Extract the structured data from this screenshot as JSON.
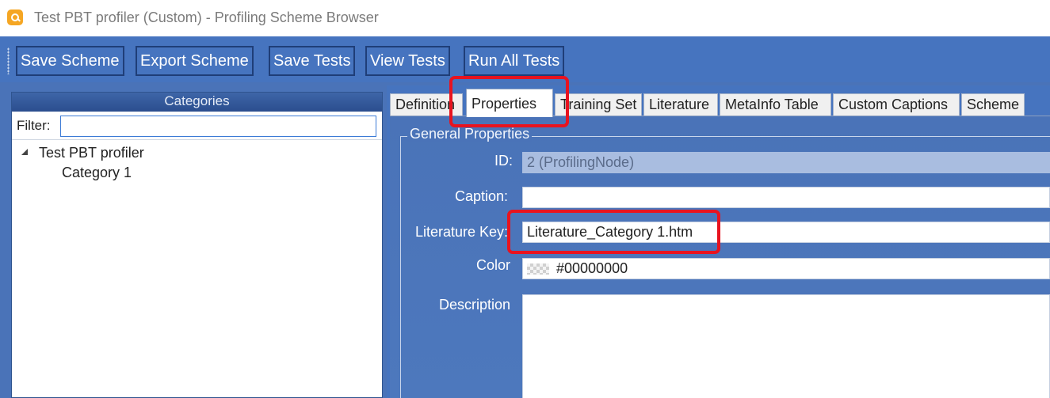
{
  "window": {
    "title": "Test PBT profiler (Custom) - Profiling Scheme Browser"
  },
  "toolbar": {
    "buttons": [
      "Save Scheme",
      "Export Scheme",
      "Save Tests",
      "View Tests",
      "Run All Tests"
    ]
  },
  "categories_panel": {
    "header": "Categories",
    "filter_label": "Filter:",
    "filter_value": "",
    "tree": {
      "root": "Test PBT profiler",
      "children": [
        "Category 1"
      ]
    }
  },
  "tabs": {
    "items": [
      "Definition",
      "Properties",
      "Training Set",
      "Literature",
      "MetaInfo Table",
      "Custom Captions",
      "Scheme"
    ],
    "active": "Properties"
  },
  "general_properties": {
    "title": "General Properties",
    "id_label": "ID:",
    "id_value": "2 (ProfilingNode)",
    "caption_label": "Caption:",
    "caption_value": "",
    "literature_key_label": "Literature Key:",
    "literature_key_value": "Literature_Category 1.htm",
    "color_label": "Color",
    "color_value": "#00000000",
    "description_label": "Description",
    "description_value": ""
  },
  "colors": {
    "accent_blue": "#4674bf",
    "highlight_red": "#e8131f",
    "app_icon": "#f5a623"
  }
}
